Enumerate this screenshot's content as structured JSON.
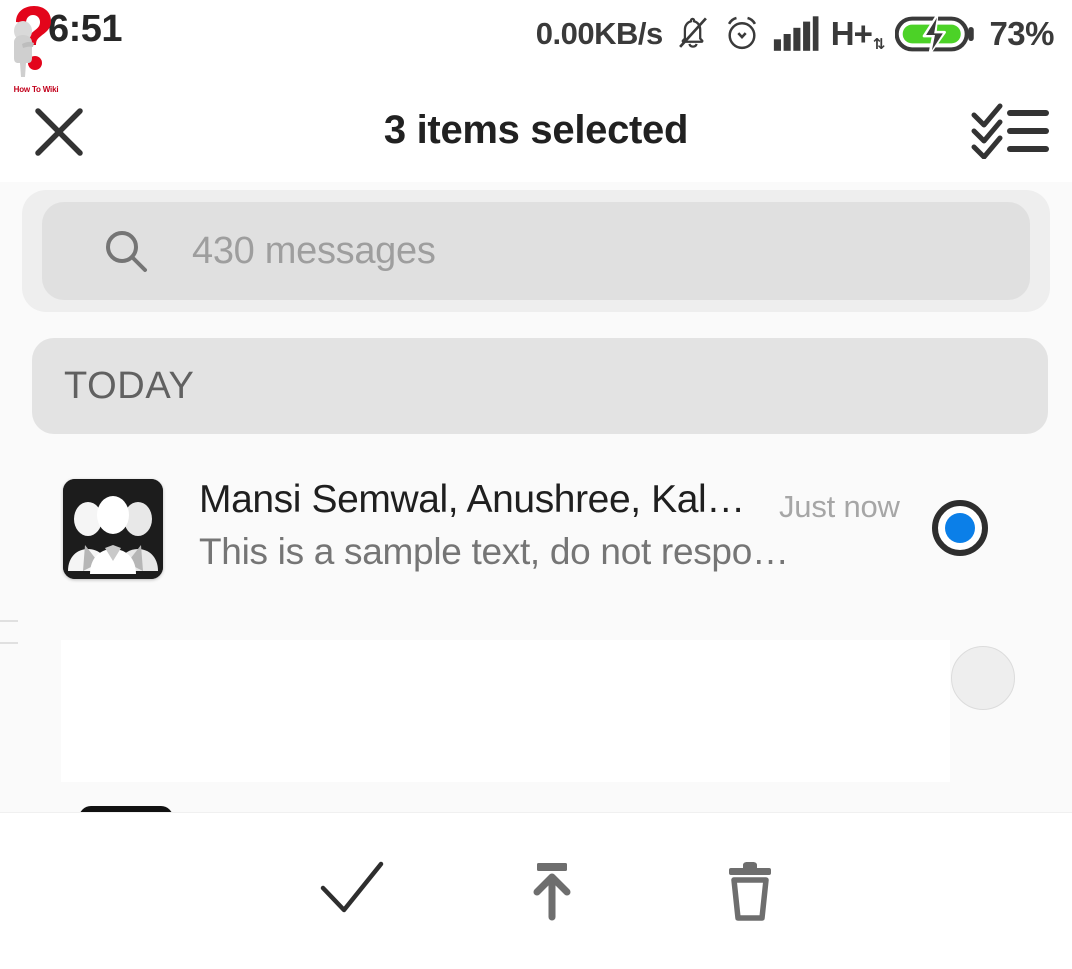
{
  "status_bar": {
    "time": "6:51",
    "network_speed": "0.00KB/s",
    "network_type": "H+",
    "battery_percent": "73%",
    "icons": {
      "mute": "bell-muted-icon",
      "alarm": "alarm-clock-icon",
      "signal": "signal-bars-icon",
      "data_transfer": "data-updown-icon",
      "battery": "battery-charging-icon"
    },
    "battery_color": "#4CD227"
  },
  "watermark": {
    "label": "How To Wiki",
    "color": "#c2001b"
  },
  "app_bar": {
    "close_icon": "close-icon",
    "title": "3 items selected",
    "select_all_icon": "select-all-checklist-icon"
  },
  "search": {
    "icon": "search-icon",
    "placeholder": "430 messages",
    "value": ""
  },
  "section": {
    "today_label": "TODAY"
  },
  "conversation": {
    "avatar": "group-avatar-icon",
    "title": "Mansi Semwal, Anushree, Kal…",
    "timestamp": "Just now",
    "snippet": "This is a sample text, do not respo…",
    "selected": true,
    "selected_color": "#0b7fe8"
  },
  "bottom_toolbar": {
    "actions": [
      {
        "name": "mark-read",
        "icon": "checkmark-icon"
      },
      {
        "name": "archive",
        "icon": "archive-up-arrow-icon"
      },
      {
        "name": "delete",
        "icon": "trash-icon"
      }
    ]
  }
}
